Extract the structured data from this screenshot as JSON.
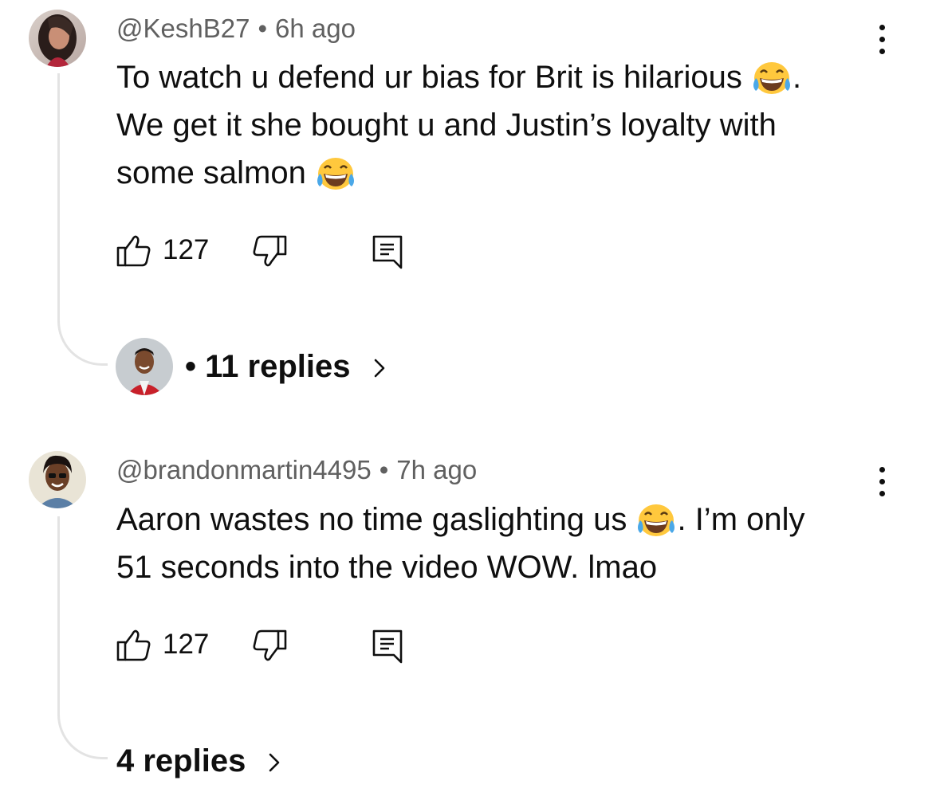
{
  "comments": [
    {
      "handle": "@KeshB27",
      "separator": "•",
      "time": "6h ago",
      "text_lines": [
        "To watch u defend ur bias for Brit is hilarious ",
        "We get it she bought u and Justin’s loyalty with",
        "some salmon "
      ],
      "line1_after_emoji": ".",
      "likes": "127",
      "replies_prefix": "•",
      "replies_label": "11 replies"
    },
    {
      "handle": "@brandonmartin4495",
      "separator": "•",
      "time": "7h ago",
      "text_lines": [
        "Aaron wastes no time gaslighting us ",
        "51 seconds into the video WOW. lmao"
      ],
      "line1_after_emoji": ". I’m only",
      "likes": "127",
      "replies_label": "4 replies"
    }
  ],
  "icons": {
    "like": "thumbs-up-icon",
    "dislike": "thumbs-down-icon",
    "reply": "reply-comment-icon",
    "more": "more-vertical-icon",
    "emoji": "face-with-tears-of-joy-emoji",
    "chevron": "chevron-right-icon"
  },
  "colors": {
    "text": "#0f0f0f",
    "meta": "#606060",
    "thread_line": "#e3e3e3",
    "emoji_face": "#ffc83d",
    "emoji_tears": "#4aa8e8"
  }
}
